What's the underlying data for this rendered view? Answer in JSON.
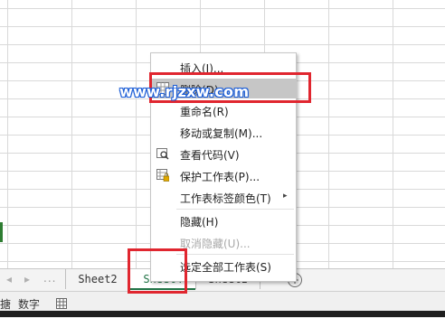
{
  "sheet_tabs": [
    "Sheet2",
    "Sheet4",
    "Sheet1"
  ],
  "active_tab_index": 1,
  "nav": {
    "prev": "◂",
    "next": "▸",
    "more": "..."
  },
  "add_sheet_symbol": "+",
  "status": {
    "left_fragment": "搪",
    "mode": "数字"
  },
  "watermark": "www.rjzxw.com",
  "context_menu": {
    "items": [
      {
        "label": "插入(I)...",
        "icon": "none",
        "enabled": true
      },
      {
        "label": "删除(D)",
        "icon": "delete-sheet-icon",
        "enabled": true,
        "highlighted": true
      },
      {
        "label": "重命名(R)",
        "icon": "none",
        "enabled": true
      },
      {
        "label": "移动或复制(M)...",
        "icon": "none",
        "enabled": true
      },
      {
        "label": "查看代码(V)",
        "icon": "view-code-icon",
        "enabled": true
      },
      {
        "label": "保护工作表(P)...",
        "icon": "protect-sheet-icon",
        "enabled": true
      },
      {
        "label": "工作表标签颜色(T)",
        "icon": "none",
        "enabled": true,
        "submenu": "▸"
      },
      {
        "label": "隐藏(H)",
        "icon": "none",
        "enabled": true
      },
      {
        "label": "取消隐藏(U)...",
        "icon": "none",
        "enabled": false
      },
      {
        "label": "选定全部工作表(S)",
        "icon": "none",
        "enabled": true
      }
    ]
  },
  "colors": {
    "highlight": "#c6c6c6",
    "annotation_red": "#e0262f",
    "active_tab_green": "#217346"
  }
}
